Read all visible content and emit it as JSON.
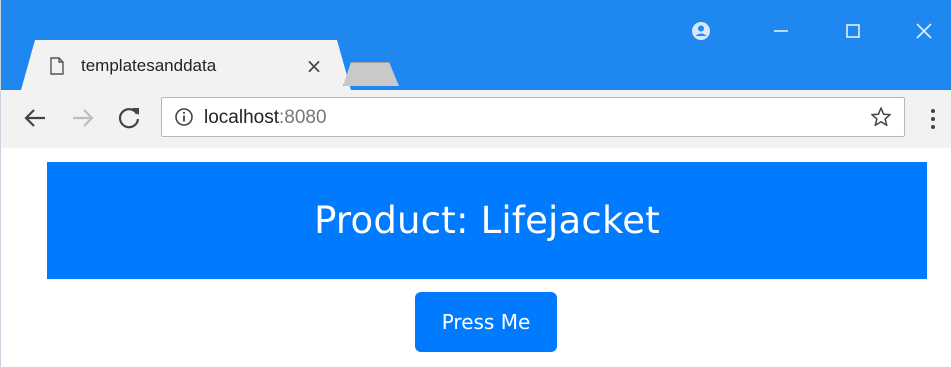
{
  "browser": {
    "tab_title": "templatesanddata",
    "url_host": "localhost",
    "url_port": ":8080",
    "accent_color": "#1e88f0"
  },
  "icons": {
    "tab": "page-icon",
    "tab_close": "close-icon",
    "profile": "profile-icon",
    "minimize": "minimize-icon",
    "maximize": "maximize-icon",
    "close": "close-icon",
    "back": "back-arrow-icon",
    "forward": "forward-arrow-icon",
    "reload": "reload-icon",
    "info": "info-icon",
    "bookmark": "star-icon",
    "menu": "more-vert-icon"
  },
  "page": {
    "heading": "Product: Lifejacket",
    "button_label": "Press Me",
    "primary_color": "#007bff"
  }
}
